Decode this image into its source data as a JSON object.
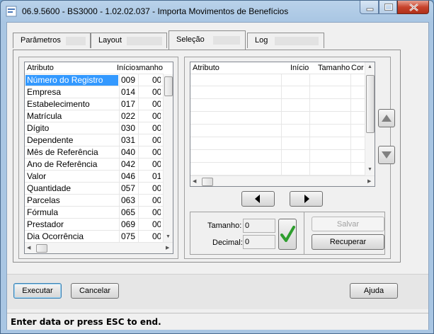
{
  "window": {
    "title": "06.9.5600 - BS3000 - 1.02.02.037 - Importa Movimentos de Benefícios"
  },
  "tabs": [
    {
      "label": "Parâmetros"
    },
    {
      "label": "Layout"
    },
    {
      "label": "Seleção"
    },
    {
      "label": "Log"
    }
  ],
  "left_grid": {
    "headers": {
      "attr": "Atributo",
      "start": "Início",
      "size": "Tamanho"
    },
    "rows": [
      {
        "attr": "Número do Registro",
        "start": "009",
        "size": "00"
      },
      {
        "attr": "Empresa",
        "start": "014",
        "size": "00"
      },
      {
        "attr": "Estabelecimento",
        "start": "017",
        "size": "00"
      },
      {
        "attr": "Matrícula",
        "start": "022",
        "size": "00"
      },
      {
        "attr": "Dígito",
        "start": "030",
        "size": "00"
      },
      {
        "attr": "Dependente",
        "start": "031",
        "size": "00"
      },
      {
        "attr": "Mês de Referência",
        "start": "040",
        "size": "00"
      },
      {
        "attr": "Ano de Referência",
        "start": "042",
        "size": "00"
      },
      {
        "attr": "Valor",
        "start": "046",
        "size": "01"
      },
      {
        "attr": "Quantidade",
        "start": "057",
        "size": "00"
      },
      {
        "attr": "Parcelas",
        "start": "063",
        "size": "00"
      },
      {
        "attr": "Fórmula",
        "start": "065",
        "size": "00"
      },
      {
        "attr": "Prestador",
        "start": "069",
        "size": "00"
      },
      {
        "attr": "Dia Ocorrência",
        "start": "075",
        "size": "00"
      }
    ]
  },
  "right_grid": {
    "headers": {
      "attr": "Atributo",
      "start": "Início",
      "size": "Tamanho",
      "extra": "Cor"
    }
  },
  "size_panel": {
    "size_label": "Tamanho:",
    "size_value": "0",
    "decimal_label": "Decimal:",
    "decimal_value": "0"
  },
  "buttons": {
    "save": "Salvar",
    "recover": "Recuperar",
    "execute": "Executar",
    "cancel": "Cancelar",
    "help": "Ajuda"
  },
  "status": {
    "text": "Enter data or press ESC to end."
  },
  "colors": {
    "selection": "#3399ff",
    "confirm_check": "#2e9e2e"
  }
}
